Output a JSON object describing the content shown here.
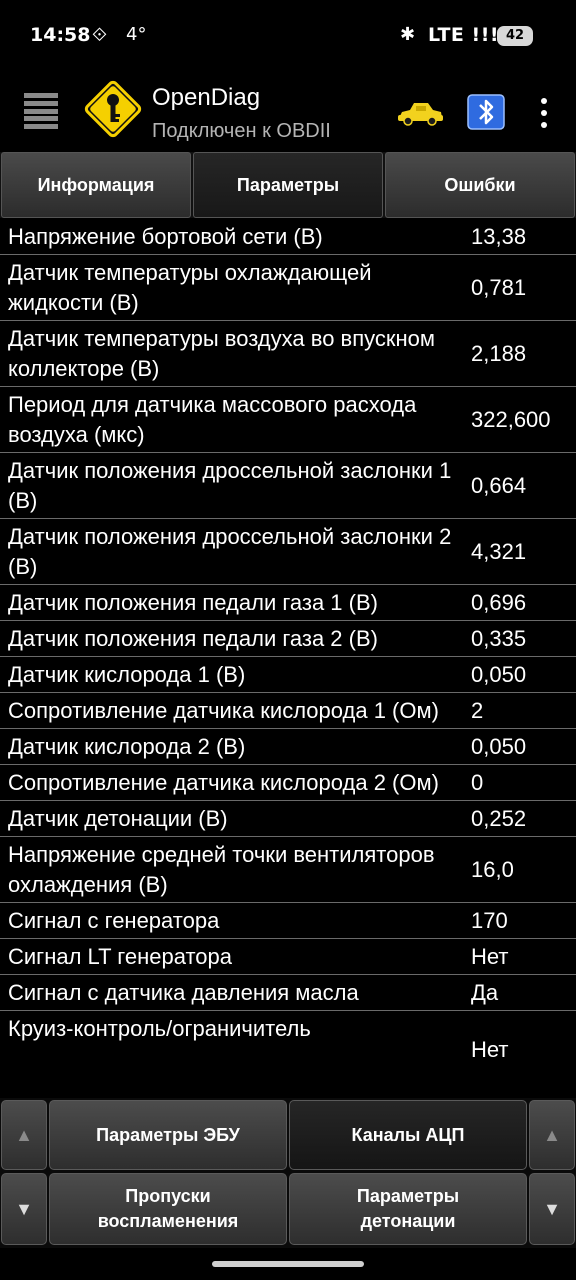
{
  "status_bar": {
    "time": "14:58",
    "temperature": "4°",
    "network": "LTE",
    "signal": "!!!!",
    "battery": "42"
  },
  "app_bar": {
    "title": "OpenDiag",
    "subtitle": "Подключен к OBDII",
    "menu_icon": "hamburger-icon",
    "logo_icon": "key-sign-icon",
    "car_icon": "car-icon",
    "bluetooth_icon": "bluetooth-icon",
    "overflow_icon": "more-vert-icon"
  },
  "tabs": [
    {
      "label": "Информация",
      "active": false
    },
    {
      "label": "Параметры",
      "active": true
    },
    {
      "label": "Ошибки",
      "active": false
    }
  ],
  "parameters": [
    {
      "name": "Напряжение бортовой сети (В)",
      "value": "13,38"
    },
    {
      "name": "Датчик температуры охлаждающей жидкости (В)",
      "value": "0,781"
    },
    {
      "name": "Датчик температуры воздуха во впускном коллекторе (В)",
      "value": "2,188"
    },
    {
      "name": "Период для датчика массового расхода воздуха (мкс)",
      "value": "322,600"
    },
    {
      "name": "Датчик положения дроссельной заслонки 1 (В)",
      "value": "0,664"
    },
    {
      "name": "Датчик положения дроссельной заслонки 2 (В)",
      "value": "4,321"
    },
    {
      "name": "Датчик положения педали газа 1 (В)",
      "value": "0,696"
    },
    {
      "name": "Датчик положения педали газа 2 (В)",
      "value": "0,335"
    },
    {
      "name": "Датчик кислорода 1 (В)",
      "value": "0,050"
    },
    {
      "name": "Сопротивление датчика кислорода 1 (Ом)",
      "value": "2"
    },
    {
      "name": "Датчик кислорода 2 (В)",
      "value": "0,050"
    },
    {
      "name": "Сопротивление датчика кислорода 2 (Ом)",
      "value": "0"
    },
    {
      "name": "Датчик детонации (В)",
      "value": "0,252"
    },
    {
      "name": "Напряжение средней точки вентиляторов охлаждения (В)",
      "value": "16,0"
    },
    {
      "name": "Сигнал с генератора",
      "value": "170"
    },
    {
      "name": "Сигнал LT генератора",
      "value": "Нет"
    },
    {
      "name": "Сигнал с датчика давления масла",
      "value": "Да"
    },
    {
      "name": "Круиз-контроль/ограничитель",
      "value": "Нет"
    }
  ],
  "bottom_buttons": {
    "up_left": "▲",
    "down_left": "▼",
    "up_right": "▲",
    "down_right": "▼",
    "ecu_params": "Параметры ЭБУ",
    "adc_channels": "Каналы АЦП",
    "misfires": "Пропуски воспламенения",
    "knock_params": "Параметры детонации"
  },
  "colors": {
    "background": "#000000",
    "logo_yellow": "#f5d000",
    "car_yellow": "#f2d21e",
    "bluetooth_blue": "#2f6be0"
  }
}
